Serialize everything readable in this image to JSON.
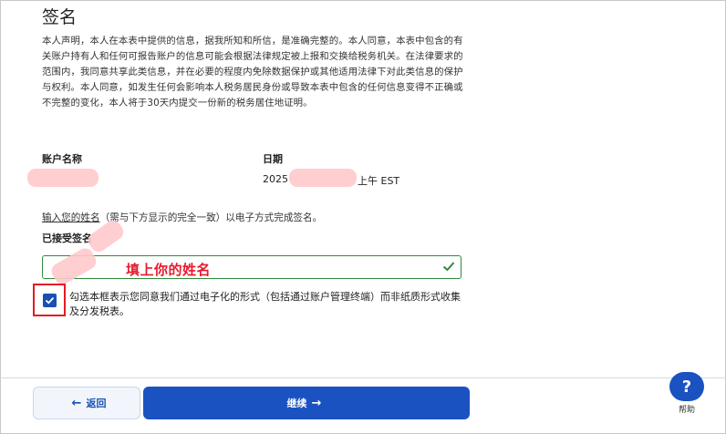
{
  "page": {
    "title": "签名",
    "declaration": "本人声明，本人在本表中提供的信息，据我所知和所信，是准确完整的。本人同意，本表中包含的有关账户持有人和任何可报告账户的信息可能会根据法律规定被上报和交换给税务机关。在法律要求的范围内，我同意共享此类信息，并在必要的程度内免除数据保护或其他适用法律下对此类信息的保护与权利。本人同意，如发生任何会影响本人税务居民身份或导致本表中包含的任何信息变得不正确或不完整的变化，本人将于30天内提交一份新的税务居住地证明。"
  },
  "account": {
    "name_label": "账户名称",
    "date_label": "日期",
    "date_prefix": "2025",
    "date_suffix": "上午 EST"
  },
  "signature": {
    "instruction_link": "输入您的姓名",
    "instruction_rest": "（需与下方显示的完全一致）以电子方式完成签名。",
    "accepted_label": "已接受签名",
    "annotation": "填上你的姓名"
  },
  "consent": {
    "text": "勾选本框表示您同意我们通过电子化的形式（包括通过账户管理终端）而非纸质形式收集及分发税表。",
    "checked": true
  },
  "footer": {
    "back_label": "返回",
    "next_label": "继续",
    "back_arrow": "←",
    "next_arrow": "→",
    "help_label": "帮助",
    "help_glyph": "?"
  },
  "colors": {
    "primary": "#1a52c2",
    "annotation_red": "#e8192c",
    "valid_green": "#2e8b3e"
  }
}
